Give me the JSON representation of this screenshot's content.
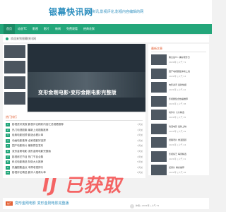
{
  "header": {
    "site_title": "银幕快讯网",
    "tagline": "影视资讯,影视评论,影视内容编辑的网"
  },
  "nav": {
    "items": [
      {
        "label": "首页"
      },
      {
        "label": "动态TC"
      },
      {
        "label": "影视"
      },
      {
        "label": "影片"
      },
      {
        "label": "新闻"
      },
      {
        "label": "免费观看"
      },
      {
        "label": "经典花絮"
      }
    ]
  },
  "notice": {
    "text": "欢迎来到银幕快讯网"
  },
  "banner": {
    "caption": "变形金刚电影·变形金刚电影完整版"
  },
  "sidebar": {
    "title": "最新文章",
    "items": [
      {
        "title": "黑太后TC: 美好观影日",
        "meta": "2020年 | 人气 71"
      },
      {
        "title": "国产电视剧集体新上线",
        "meta": "2021年 | 人气 53"
      },
      {
        "title": "电影资讯 最新快报",
        "meta": "2021年 | 人气 42"
      },
      {
        "title": "影视剧集合热播推荐",
        "meta": "2021年 | 人气 38"
      },
      {
        "title": "动作片 大片精选",
        "meta": "2021年 | 人气 35"
      },
      {
        "title": "动漫电影 最新上映",
        "meta": "2021年 | 人气 29"
      },
      {
        "title": "经典老片 重温回顾",
        "meta": "2021年 | 人气 24"
      },
      {
        "title": "影视综艺 每周精选",
        "meta": "2021年 | 人气 21"
      },
      {
        "title": "纪录片 精彩推荐",
        "meta": "2021年 | 人气 18"
      }
    ]
  },
  "list": {
    "title": "热门排行",
    "rows": [
      {
        "num": "1",
        "title": "影视资讯快报 影视评论精彩内容汇总观看推荐",
        "date": "1天前"
      },
      {
        "num": "2",
        "title": "热门电视剧集 最新上线剧集推荐",
        "date": "1天前"
      },
      {
        "num": "3",
        "title": "经典电影回顾 影迷必看片单",
        "date": "2天前"
      },
      {
        "num": "4",
        "title": "动画电影推荐 全家观影好选择",
        "date": "2天前"
      },
      {
        "num": "5",
        "title": "国产电影新片 最新预告发布",
        "date": "3天前"
      },
      {
        "num": "6",
        "title": "变形金刚电影 变形金刚电影完整版",
        "date": "3天前"
      },
      {
        "num": "7",
        "title": "影视综艺节目 热门节目合集",
        "date": "4天前"
      },
      {
        "num": "8",
        "title": "科幻电影精选 特效大片推荐",
        "date": "5天前"
      },
      {
        "num": "9",
        "title": "热播剧集盘点 本周收视排行",
        "date": "5天前"
      },
      {
        "num": "10",
        "title": "影视评论精选 影评人推荐片单",
        "date": "6天前"
      }
    ]
  },
  "watermark": {
    "text": "IJ 已获取"
  },
  "footer": {
    "tag": "热门",
    "title": "变形金刚电影 变形金刚电影完整版",
    "meta": "作者 | 2021年 | 人气 71"
  },
  "colors": {
    "nav_green": "#23a67a",
    "brand_blue": "#2e8fbf",
    "accent_orange": "#e25b2e"
  }
}
